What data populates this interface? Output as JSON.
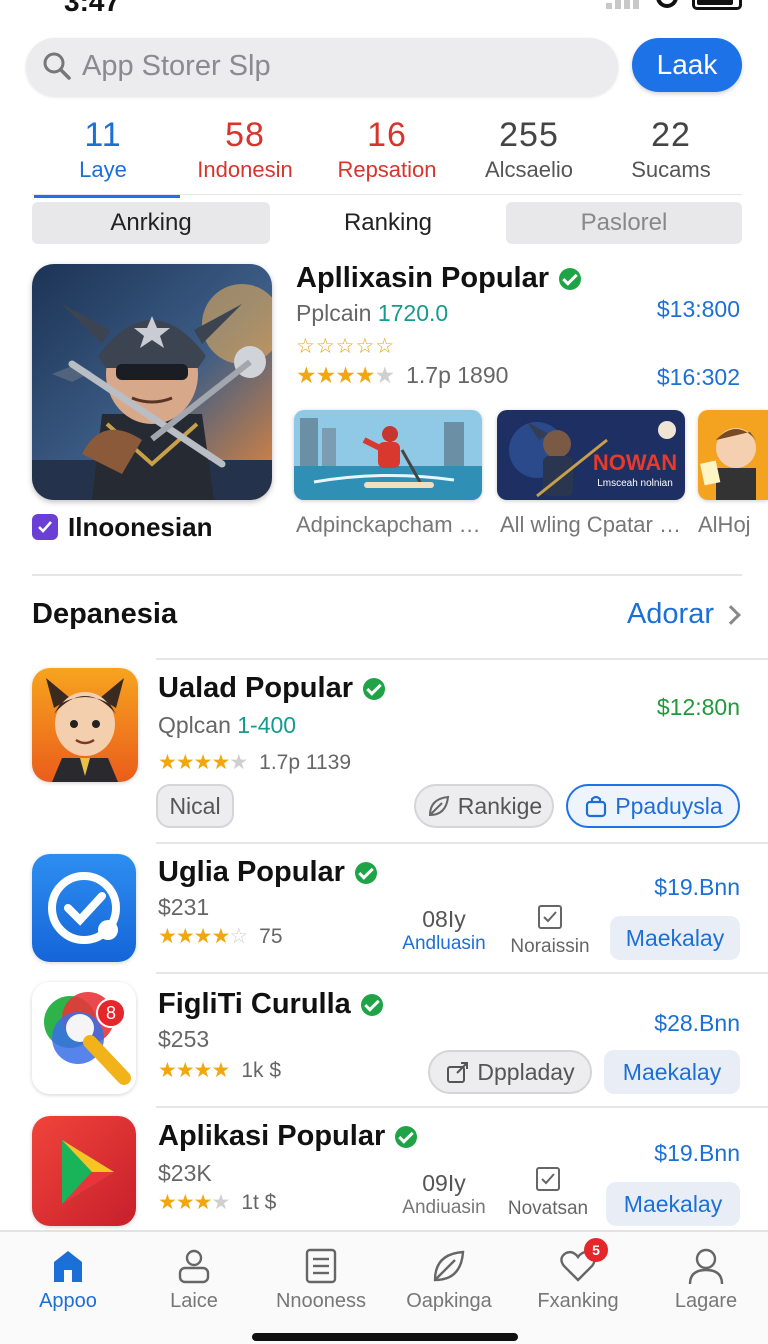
{
  "status": {
    "time": "3:47"
  },
  "search": {
    "placeholder": "App Storer Slp",
    "button": "Laak"
  },
  "stats": [
    {
      "value": "11",
      "label": "Laye",
      "color": "#1d6fd8"
    },
    {
      "value": "58",
      "label": "Indonesin",
      "color": "#d8342c"
    },
    {
      "value": "16",
      "label": "Repsation",
      "color": "#d8342c"
    },
    {
      "value": "255",
      "label": "Alcsaelio",
      "color": "#444444"
    },
    {
      "value": "22",
      "label": "Sucams",
      "color": "#444444"
    }
  ],
  "segments": [
    "Anrking",
    "Ranking",
    "Paslorel"
  ],
  "featured": {
    "title": "Apllixasin Popular",
    "sub_prefix": "Pplcain",
    "sub_value": "1720.0",
    "rating_text": "1.7p  1890",
    "price1": "$13:800",
    "price2": "$16:302",
    "name": "Ilnoonesian",
    "thumbs": [
      {
        "caption": "Adpinckapcham …"
      },
      {
        "caption": "All wling Cpatar …",
        "banner": "NOWAN",
        "banner_sub": "Lmsceah nolnian"
      },
      {
        "caption": "AlHoj"
      }
    ]
  },
  "section": {
    "title": "Depanesia",
    "link": "Adorar"
  },
  "apps": [
    {
      "title": "Ualad Popular",
      "sub_prefix": "Qplcan",
      "sub_value": "1-400",
      "rating_text": "1.7p  1139",
      "price": "$12:80n",
      "price_color": "#1f9a3b",
      "chip": "Nical",
      "btn1": "Rankige",
      "btn2": "Ppaduysla"
    },
    {
      "title": "Uglia Popular",
      "sub": "$231",
      "rating_text": "75",
      "price": "$19.Bnn",
      "stat_top": "08Iy",
      "stat_bottom": "Andluasin",
      "check_label": "Noraissin",
      "action": "Maekalay"
    },
    {
      "title": "FigliTi Curulla",
      "sub": "$253",
      "rating_text": "1k  $",
      "price": "$28.Bnn",
      "badge": "8",
      "btn": "Dppladay",
      "action": "Maekalay"
    },
    {
      "title": "Aplikasi Popular",
      "sub": "$23K",
      "rating_text": "1t  $",
      "price": "$19.Bnn",
      "stat_top": "09Iy",
      "stat_bottom": "Andiuasin",
      "check_label": "Novatsan",
      "action": "Maekalay"
    }
  ],
  "tabs": [
    {
      "label": "Appoo",
      "icon": "home-icon"
    },
    {
      "label": "Laice",
      "icon": "person-icon"
    },
    {
      "label": "Nnooness",
      "icon": "list-icon"
    },
    {
      "label": "Oapkinga",
      "icon": "leaf-icon"
    },
    {
      "label": "Fxanking",
      "icon": "heart-icon",
      "badge": "5"
    },
    {
      "label": "Lagare",
      "icon": "profile-icon"
    }
  ]
}
